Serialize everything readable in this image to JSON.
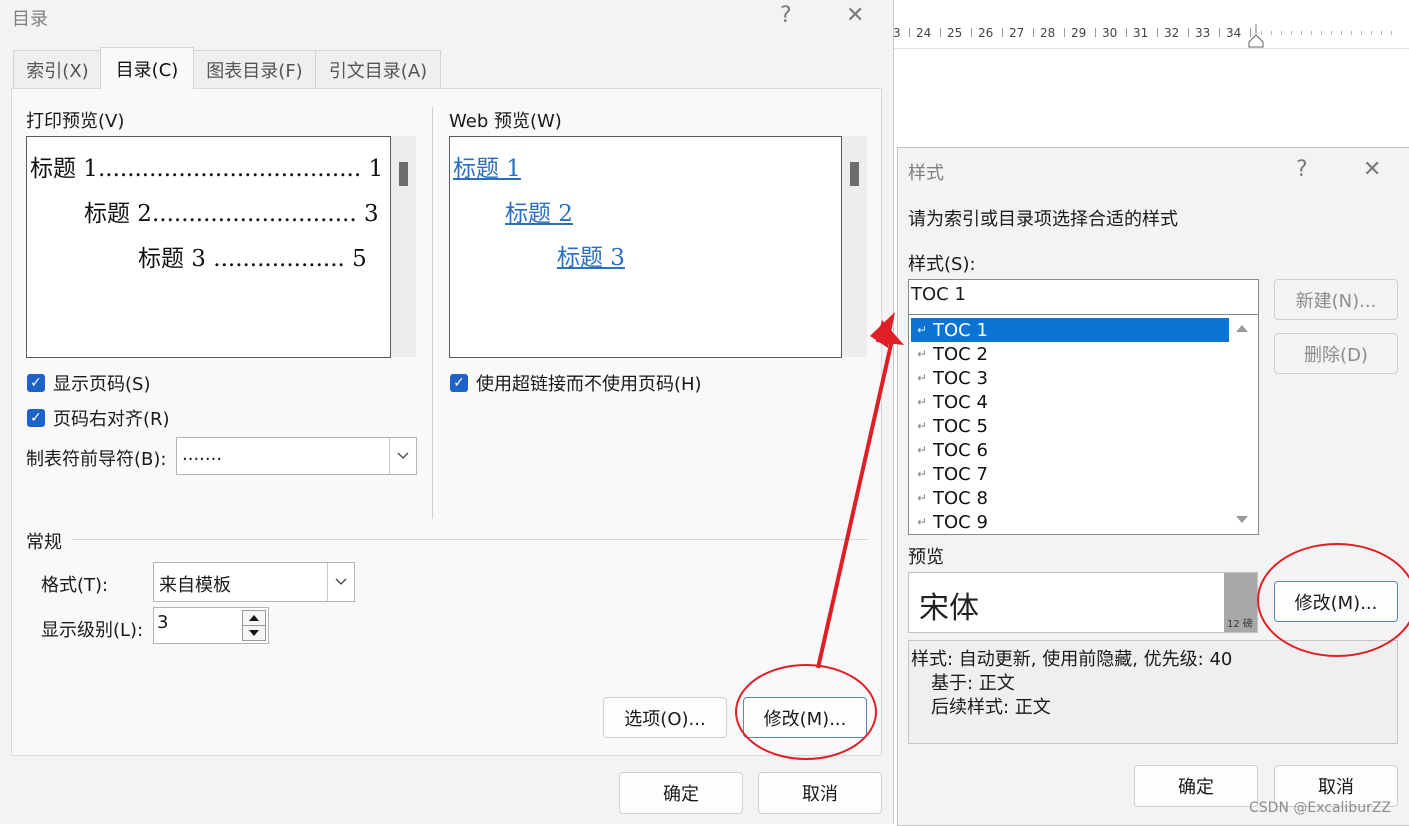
{
  "ruler": {
    "numbers": [
      "3",
      "24",
      "25",
      "26",
      "27",
      "28",
      "29",
      "30",
      "31",
      "32",
      "33",
      "34"
    ]
  },
  "toc_dialog": {
    "title": "目录",
    "help": "?",
    "close": "✕",
    "tabs": [
      {
        "label": "索引(X)"
      },
      {
        "label": "目录(C)"
      },
      {
        "label": "图表目录(F)"
      },
      {
        "label": "引文目录(A)"
      }
    ],
    "print_preview": {
      "label": "打印预览(V)",
      "lines": [
        {
          "text": "标题  1....................................  1"
        },
        {
          "text": "标题  2............................  3"
        },
        {
          "text": "标题  3 ..................  5"
        }
      ]
    },
    "web_preview": {
      "label": "Web 预览(W)",
      "links": [
        "标题  1",
        "标题  2",
        "标题  3"
      ]
    },
    "show_page_numbers": {
      "label": "显示页码(S)",
      "checked": true
    },
    "right_align": {
      "label": "页码右对齐(R)",
      "checked": true
    },
    "use_hyperlinks": {
      "label": "使用超链接而不使用页码(H)",
      "checked": true
    },
    "tab_leader": {
      "label": "制表符前导符(B):",
      "value": "......."
    },
    "general": {
      "heading": "常规",
      "format_label": "格式(T):",
      "format_value": "来自模板",
      "levels_label": "显示级别(L):",
      "levels_value": "3"
    },
    "options_button": "选项(O)...",
    "modify_button": "修改(M)...",
    "ok_button": "确定",
    "cancel_button": "取消"
  },
  "style_dialog": {
    "title": "样式",
    "help": "?",
    "close": "✕",
    "instruction": "请为索引或目录项选择合适的样式",
    "styles_label": "样式(S):",
    "styles_value": "TOC 1",
    "items": [
      "TOC 1",
      "TOC 2",
      "TOC 3",
      "TOC 4",
      "TOC 5",
      "TOC 6",
      "TOC 7",
      "TOC 8",
      "TOC 9"
    ],
    "selected_index": 0,
    "new_button": "新建(N)...",
    "delete_button": "删除(D)",
    "preview_label": "预览",
    "preview_font": "宋体",
    "preview_size": "12 磅",
    "modify_button": "修改(M)...",
    "description": {
      "line1": "样式: 自动更新, 使用前隐藏, 优先级: 40",
      "line2": "基于: 正文",
      "line3": "后续样式: 正文"
    },
    "ok_button": "确定",
    "cancel_button": "取消"
  },
  "annotation_color": "#e01e25",
  "accent_color": "#0a73d4",
  "watermark": "CSDN @ExcaliburZZ"
}
